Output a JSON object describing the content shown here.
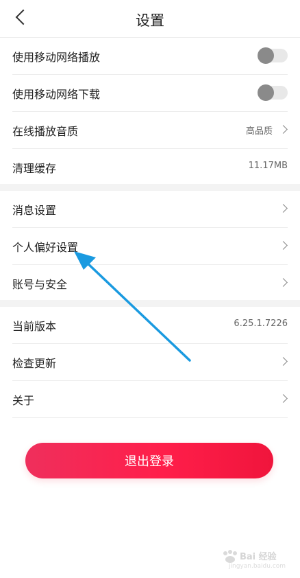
{
  "header": {
    "title": "设置"
  },
  "group1": [
    {
      "label": "使用移动网络播放",
      "type": "toggle",
      "on": false
    },
    {
      "label": "使用移动网络下载",
      "type": "toggle",
      "on": false
    },
    {
      "label": "在线播放音质",
      "value": "高品质",
      "type": "select"
    },
    {
      "label": "清理缓存",
      "value": "11.17MB",
      "type": "value"
    }
  ],
  "group2": [
    {
      "label": "消息设置"
    },
    {
      "label": "个人偏好设置"
    },
    {
      "label": "账号与安全"
    }
  ],
  "group3": [
    {
      "label": "当前版本",
      "value": "6.25.1.7226"
    },
    {
      "label": "检查更新"
    },
    {
      "label": "关于"
    }
  ],
  "logout_label": "退出登录",
  "watermark": {
    "brand": "Bai 经验",
    "sub": "jingyan.baidu.com"
  },
  "colors": {
    "accent": "#f01e48",
    "annotation_arrow": "#1a9ae0"
  }
}
